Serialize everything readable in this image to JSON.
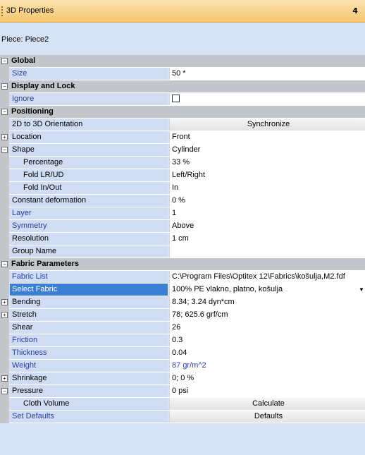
{
  "panel": {
    "title": "3D Properties",
    "pin_icon": "pin-icon"
  },
  "piece_label": "Piece: Piece2",
  "sections": {
    "global": "Global",
    "display_lock": "Display and Lock",
    "positioning": "Positioning",
    "fabric": "Fabric Parameters"
  },
  "rows": {
    "size": {
      "name": "Size",
      "value": "50 *"
    },
    "ignore": {
      "name": "Ignore"
    },
    "orientation": {
      "name": "2D to 3D Orientation",
      "value": "Synchronize"
    },
    "location": {
      "name": "Location",
      "value": "Front"
    },
    "shape": {
      "name": "Shape",
      "value": "Cylinder"
    },
    "percentage": {
      "name": "Percentage",
      "value": "33 %"
    },
    "fold_lrud": {
      "name": "Fold LR/UD",
      "value": "Left/Right"
    },
    "fold_inout": {
      "name": "Fold In/Out",
      "value": "In"
    },
    "constant_def": {
      "name": "Constant deformation",
      "value": "0 %"
    },
    "layer": {
      "name": "Layer",
      "value": "1"
    },
    "symmetry": {
      "name": "Symmetry",
      "value": "Above"
    },
    "resolution": {
      "name": "Resolution",
      "value": "1 cm"
    },
    "group_name": {
      "name": "Group Name",
      "value": ""
    },
    "fabric_list": {
      "name": "Fabric List",
      "value": "C:\\Program Files\\Optitex 12\\Fabrics\\košulja,M2.fdf"
    },
    "select_fabric": {
      "name": "Select Fabric",
      "value": "100% PE vlakno, platno, košulja"
    },
    "bending": {
      "name": "Bending",
      "value": "8.34; 3.24 dyn*cm"
    },
    "stretch": {
      "name": "Stretch",
      "value": "78; 625.6 grf/cm"
    },
    "shear": {
      "name": "Shear",
      "value": "26"
    },
    "friction": {
      "name": "Friction",
      "value": "0.3"
    },
    "thickness": {
      "name": "Thickness",
      "value": "0.04"
    },
    "weight": {
      "name": "Weight",
      "value": "87",
      "unit": "gr/m^2"
    },
    "shrinkage": {
      "name": "Shrinkage",
      "value": "0; 0 %"
    },
    "pressure": {
      "name": "Pressure",
      "value": "0 psi"
    },
    "cloth_volume": {
      "name": "Cloth Volume",
      "value": "Calculate"
    },
    "set_defaults": {
      "name": "Set Defaults",
      "value": "Defaults"
    }
  }
}
